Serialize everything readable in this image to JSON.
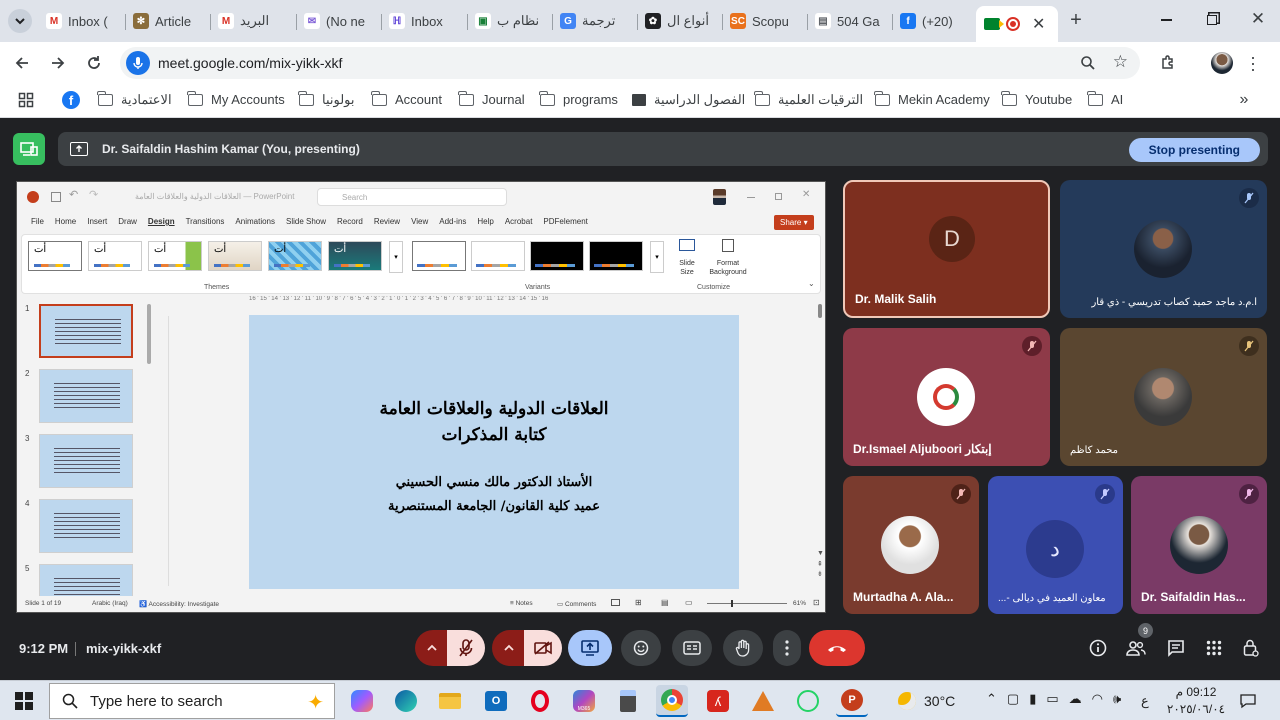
{
  "tabs": [
    {
      "label": "Inbox (",
      "icon": "gmail-icon"
    },
    {
      "label": "Article",
      "icon": "gear-icon"
    },
    {
      "label": "البريد",
      "icon": "gmail-icon"
    },
    {
      "label": "(No ne",
      "icon": "mail-icon"
    },
    {
      "label": "Inbox",
      "icon": "inbox-icon"
    },
    {
      "label": "نظام ب",
      "icon": "app-icon"
    },
    {
      "label": "ترجمة",
      "icon": "translate-icon"
    },
    {
      "label": "أنواع ال",
      "icon": "openai-icon"
    },
    {
      "label": "Scopu",
      "icon": "scopus-icon",
      "favtext": "SC"
    },
    {
      "label": "504 Ga",
      "icon": "page-icon"
    },
    {
      "label": "(+20)",
      "icon": "facebook-icon"
    }
  ],
  "address": {
    "url": "meet.google.com/mix-yikk-xkf"
  },
  "bookmarks": [
    {
      "label": "الاعتمادية",
      "kind": "folder"
    },
    {
      "label": "My Accounts",
      "kind": "folder"
    },
    {
      "label": "بولونيا",
      "kind": "folder"
    },
    {
      "label": "Account",
      "kind": "folder"
    },
    {
      "label": "Journal",
      "kind": "folder"
    },
    {
      "label": "programs",
      "kind": "folder"
    },
    {
      "label": "الفصول الدراسية",
      "kind": "classroom"
    },
    {
      "label": "الترقيات العلمية",
      "kind": "folder"
    },
    {
      "label": "Mekin Academy",
      "kind": "folder"
    },
    {
      "label": "Youtube",
      "kind": "folder"
    },
    {
      "label": "AI",
      "kind": "folder"
    }
  ],
  "presenting": {
    "text": "Dr. Saifaldin Hashim Kamar (You, presenting)",
    "stop_label": "Stop presenting"
  },
  "ppt": {
    "title": "العلاقات الدولية والعلاقات العامة — PowerPoint",
    "search": "Search",
    "menu": [
      "File",
      "Home",
      "Insert",
      "Draw",
      "Design",
      "Transitions",
      "Animations",
      "Slide Show",
      "Record",
      "Review",
      "View",
      "Add-ins",
      "Help",
      "Acrobat",
      "PDFelement"
    ],
    "share": "Share",
    "groups": {
      "themes": "Themes",
      "variants": "Variants",
      "customize": "Customize"
    },
    "slide_size": "Slide Size",
    "format_bg": "Format Background",
    "theme_glyph": "أت",
    "slide_numbers": [
      "1",
      "2",
      "3",
      "4",
      "5"
    ],
    "ruler": "16 ' 15 ' 14 ' 13 ' 12 ' 11 ' 10 ' 9 ' 8 ' 7 ' 6 ' 5 ' 4 ' 3 ' 2 ' 1 ' 0 ' 1 ' 2 ' 3 ' 4 ' 5 ' 6 ' 7 ' 8 ' 9 ' 10 ' 11 ' 12 ' 13 ' 14 ' 15 ' 16",
    "slide": {
      "title1": "العلاقات الدولية والعلاقات العامة",
      "title2": "كتابة المذكرات",
      "line1": "الأستاذ الدكتور مالك منسي الحسيني",
      "line2": "عميد كلية القانون/ الجامعة المستنصرية"
    },
    "status": {
      "slide": "Slide 1 of 19",
      "lang": "Arabic (Iraq)",
      "access": "Accessibility: Investigate",
      "notes": "Notes",
      "comments": "Comments",
      "zoom": "61%"
    }
  },
  "participants": [
    {
      "name": "Dr. Malik Salih",
      "initial": "D"
    },
    {
      "name": "ا.م.د ماجد حميد كصاب تدريسي - ذي قار"
    },
    {
      "name": "Dr.Ismael Aljuboori إبتكار"
    },
    {
      "name": "محمد كاظم"
    },
    {
      "name": "Murtadha A. Ala..."
    },
    {
      "name": "معاون العميد في ديالى -...",
      "initial": "د"
    },
    {
      "name": "Dr. Saifaldin Has..."
    }
  ],
  "meeting": {
    "time": "9:12 PM",
    "code": "mix-yikk-xkf",
    "people_count": "9"
  },
  "taskbar": {
    "search": "Type here to search",
    "temp": "30°C",
    "time": "09:12 م",
    "date": "٢٠٢٥/٠٦/٠٤",
    "lang": "ع",
    "m365": "M365"
  },
  "colors": {
    "meet_bg": "#202124",
    "end_call": "#ea4335",
    "mic_off_bg": "#8c1d18",
    "stop_btn": "#a8c7fa",
    "ppt_red": "#c43e1c"
  }
}
